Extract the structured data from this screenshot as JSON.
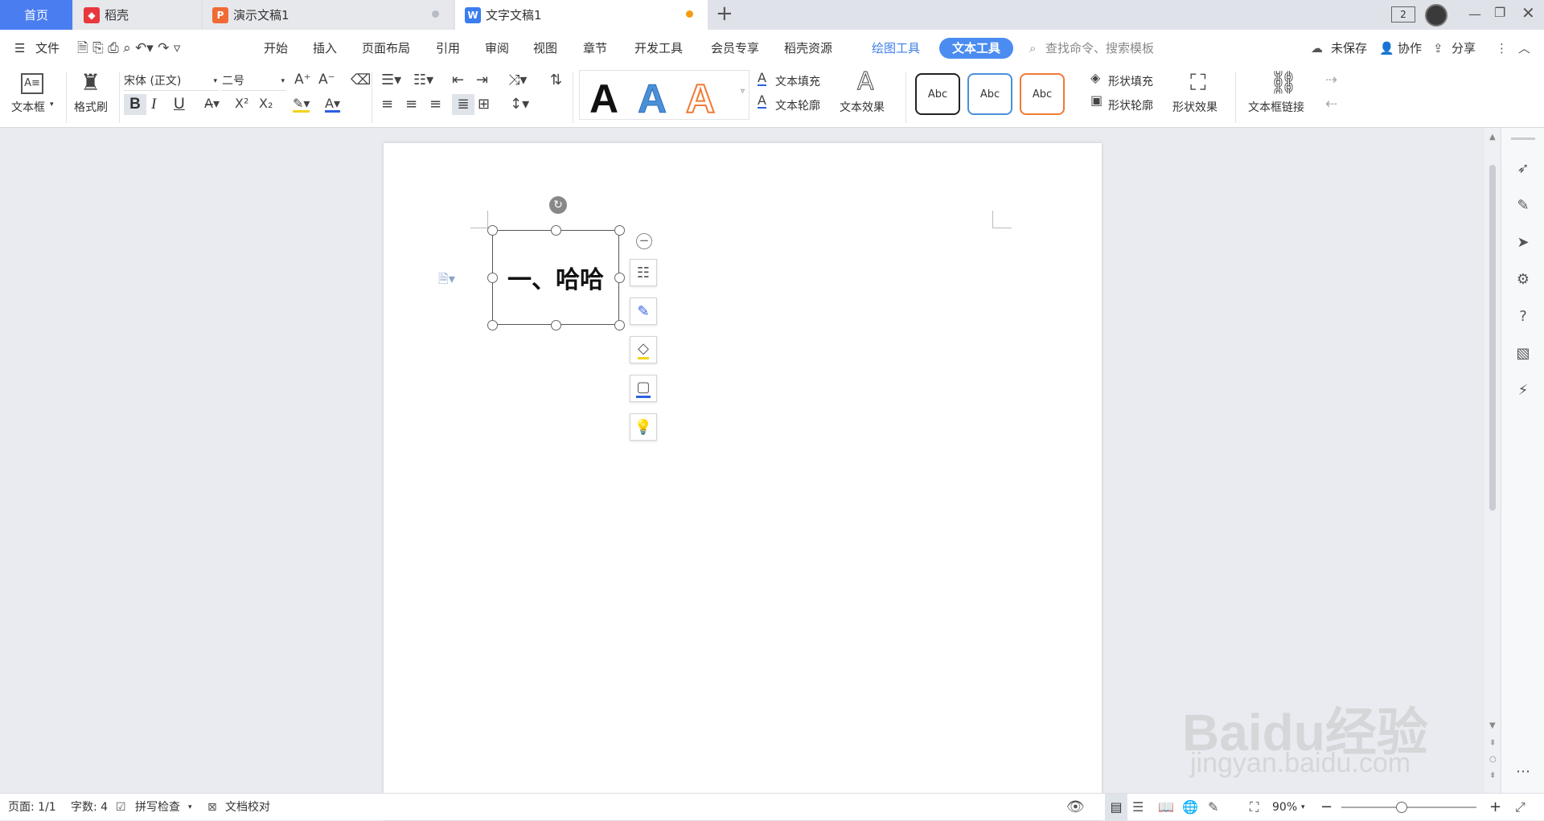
{
  "tabs": {
    "home": "首页",
    "daoke": "稻壳",
    "presentation": "演示文稿1",
    "document": "文字文稿1",
    "add": "+"
  },
  "window": {
    "counter": "2"
  },
  "menu": {
    "file": "文件",
    "start": "开始",
    "insert": "插入",
    "layout": "页面布局",
    "reference": "引用",
    "review": "审阅",
    "view": "视图",
    "chapter": "章节",
    "devtools": "开发工具",
    "member": "会员专享",
    "resources": "稻壳资源",
    "drawing_tools": "绘图工具",
    "text_tools": "文本工具",
    "search_placeholder": "查找命令、搜索模板",
    "unsaved": "未保存",
    "collaborate": "协作",
    "share": "分享"
  },
  "ribbon": {
    "textbox": "文本框",
    "format_painter": "格式刷",
    "font_name": "宋体 (正文)",
    "font_size": "二号",
    "bold": "B",
    "italic": "I",
    "underline": "U",
    "style_sample": "A",
    "text_fill": "文本填充",
    "text_outline": "文本轮廓",
    "text_effect": "文本效果",
    "shape_sample": "Abc",
    "shape_fill": "形状填充",
    "shape_outline": "形状轮廓",
    "shape_effect": "形状效果",
    "textbox_link": "文本框链接"
  },
  "document": {
    "textbox_content": "一、哈哈"
  },
  "status": {
    "page": "页面: 1/1",
    "word_count": "字数: 4",
    "spell_check": "拼写检查",
    "proofread": "文档校对",
    "zoom": "90%"
  },
  "watermark": {
    "brand": "Baidu经验",
    "url": "jingyan.baidu.com"
  },
  "colors": {
    "accent": "#4a7df0",
    "text_tools_pill": "#4a8cf0",
    "drawing_tools": "#3d7ee8",
    "modified_dot": "#f39c12",
    "daoke_icon": "#e8373d",
    "presentation_icon": "#f06a35",
    "document_icon": "#3a7df0"
  }
}
